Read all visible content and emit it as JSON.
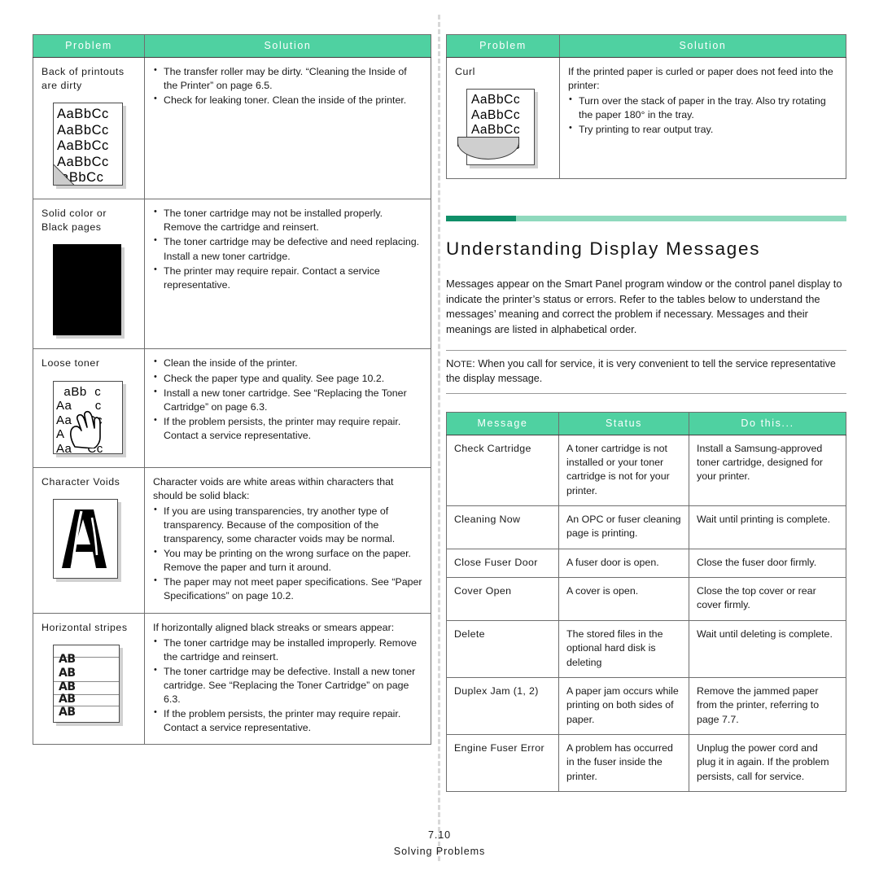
{
  "colors": {
    "header_green": "#4fd1a1",
    "rule_dark_green": "#0f8f68",
    "rule_light_green": "#8fd9bd",
    "border_gray": "#6f6f6f"
  },
  "left_table": {
    "headers": {
      "problem": "Problem",
      "solution": "Solution"
    },
    "rows": [
      {
        "problem": "Back of printouts are dirty",
        "figure": "back-of-printouts-sample",
        "figure_lines": [
          "AaBbCc",
          "AaBbCc",
          "AaBbCc",
          "AaBbCc",
          "aBbCc"
        ],
        "lead": "",
        "bullets": [
          "The transfer roller may be dirty. “Cleaning the Inside of the Printer” on page 6.5.",
          "Check for leaking toner. Clean the inside of the printer."
        ]
      },
      {
        "problem": "Solid color or Black pages",
        "figure": "solid-black-page-sample",
        "figure_lines": [],
        "lead": "",
        "bullets": [
          "The toner cartridge may not be installed properly. Remove the cartridge and reinsert.",
          "The toner cartridge may be defective and need replacing. Install a new toner cartridge.",
          "The printer may require repair. Contact a service representative."
        ]
      },
      {
        "problem": "Loose toner",
        "figure": "loose-toner-sample",
        "figure_lines": [
          "aBb  c",
          "Aa      c",
          "Aa  bCc",
          "A    bC",
          "Aa    Cc"
        ],
        "lead": "",
        "bullets": [
          "Clean the inside of the printer.",
          "Check the paper type and quality. See page 10.2.",
          "Install a new toner cartridge. See “Replacing the Toner Cartridge” on page 6.3.",
          "If the problem persists, the printer may require repair. Contact a service representative."
        ]
      },
      {
        "problem": "Character Voids",
        "figure": "character-voids-sample",
        "figure_lines": [],
        "lead": "Character voids are white areas within characters that should be solid black:",
        "bullets": [
          "If you are using transparencies, try another type of transparency. Because of the composition of the transparency, some character voids may be normal.",
          "You may be printing on the wrong surface on the paper. Remove the paper and turn it around.",
          "The paper may not meet paper specifications. See “Paper Specifications” on page 10.2."
        ]
      },
      {
        "problem": "Horizontal stripes",
        "figure": "horizontal-stripes-sample",
        "figure_lines": [
          "AB",
          "AB",
          "AB",
          "AB",
          "AB"
        ],
        "lead": "If horizontally aligned black streaks or smears appear:",
        "bullets": [
          "The toner cartridge may be installed improperly. Remove the cartridge and reinsert.",
          "The toner cartridge may be defective. Install a new toner cartridge. See “Replacing the Toner Cartridge” on page 6.3.",
          "If the problem persists, the printer may require repair. Contact a service representative."
        ]
      }
    ]
  },
  "right_table": {
    "headers": {
      "problem": "Problem",
      "solution": "Solution"
    },
    "rows": [
      {
        "problem": "Curl",
        "figure": "curl-sample",
        "figure_lines": [
          "AaBbCc",
          "AaBbCc",
          "AaBbCc",
          "AaBbCc"
        ],
        "lead": "If the printed paper is curled or paper does not feed into the printer:",
        "bullets": [
          "Turn over the stack of paper in the tray. Also try rotating the paper 180° in the tray.",
          "Try printing to rear output tray."
        ]
      }
    ]
  },
  "section": {
    "title": "Understanding Display Messages",
    "body": "Messages appear on the Smart Panel program window or the control panel display to indicate the printer’s status or errors. Refer to the tables below to understand the messages’ meaning and correct the problem if necessary. Messages and their meanings are listed in alphabetical order.",
    "note_label_first": "N",
    "note_label_rest": "OTE",
    "note_colon": ":",
    "note_text": "When you call for service, it is very convenient to tell the service representative the display message."
  },
  "message_table": {
    "headers": {
      "message": "Message",
      "status": "Status",
      "do_this": "Do this..."
    },
    "rows": [
      {
        "message": "Check Cartridge",
        "status": "A toner cartridge is not installed or your toner cartridge is not for your printer.",
        "do_this": "Install a Samsung-approved toner cartridge, designed for your printer."
      },
      {
        "message": "Cleaning Now",
        "status": "An OPC or fuser cleaning page is printing.",
        "do_this": "Wait until printing is complete."
      },
      {
        "message": "Close Fuser Door",
        "status": "A fuser door is open.",
        "do_this": "Close the fuser door firmly."
      },
      {
        "message": "Cover Open",
        "status": "A cover is open.",
        "do_this": "Close the top cover or rear cover firmly."
      },
      {
        "message": "Delete",
        "status": "The stored files in the optional hard disk is deleting",
        "do_this": "Wait until deleting is complete."
      },
      {
        "message": "Duplex Jam (1, 2)",
        "status": "A paper jam occurs while printing on both sides of paper.",
        "do_this": "Remove the jammed paper from the printer, referring to page 7.7."
      },
      {
        "message": "Engine Fuser Error",
        "status": "A problem has occurred in the fuser inside the printer.",
        "do_this": "Unplug the power cord and plug it in again. If the problem persists, call for service."
      }
    ]
  },
  "footer": {
    "page_number": "7.10",
    "chapter": "Solving Problems"
  }
}
